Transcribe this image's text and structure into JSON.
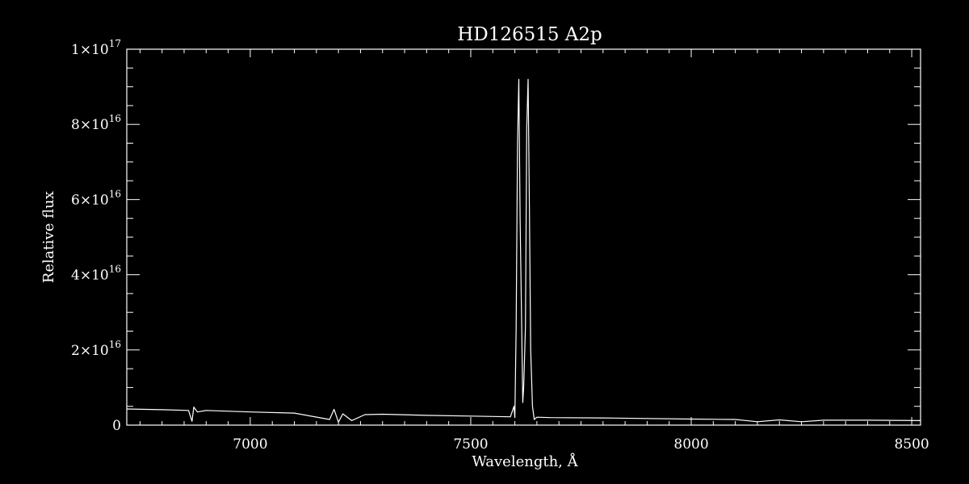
{
  "chart_data": {
    "type": "line",
    "title": "HD126515  A2p",
    "xlabel": "Wavelength, Å",
    "ylabel": "Relative flux",
    "xlim": [
      6720,
      8520
    ],
    "ylim": [
      0,
      1e+17
    ],
    "x_ticks": [
      {
        "value": 7000,
        "label": "7000"
      },
      {
        "value": 7500,
        "label": "7500"
      },
      {
        "value": 8000,
        "label": "8000"
      },
      {
        "value": 8500,
        "label": "8500"
      }
    ],
    "y_ticks": [
      {
        "value": 0,
        "mantissa": "0",
        "exponent": ""
      },
      {
        "value": 2e+16,
        "mantissa": "2×10",
        "exponent": "16"
      },
      {
        "value": 4e+16,
        "mantissa": "4×10",
        "exponent": "16"
      },
      {
        "value": 6e+16,
        "mantissa": "6×10",
        "exponent": "16"
      },
      {
        "value": 8e+16,
        "mantissa": "8×10",
        "exponent": "16"
      },
      {
        "value": 1e+17,
        "mantissa": "1×10",
        "exponent": "17"
      }
    ],
    "grid": false,
    "series": [
      {
        "color": "#ffffff",
        "x": [
          6720,
          6800,
          6860,
          6868,
          6872,
          6880,
          6900,
          7000,
          7100,
          7180,
          7190,
          7200,
          7210,
          7230,
          7260,
          7300,
          7400,
          7500,
          7590,
          7598,
          7600,
          7603,
          7606,
          7609,
          7612,
          7615,
          7618,
          7620,
          7624,
          7627,
          7630,
          7633,
          7636,
          7640,
          7644,
          7650,
          7680,
          7800,
          8000,
          8100,
          8150,
          8200,
          8250,
          8300,
          8400,
          8520
        ],
        "y": [
          4300000000000000.0,
          4100000000000000.0,
          3900000000000000.0,
          1000000000000000.0,
          4800000000000000.0,
          3500000000000000.0,
          3900000000000000.0,
          3500000000000000.0,
          3200000000000000.0,
          1500000000000000.0,
          4200000000000000.0,
          800000000000000.0,
          3000000000000000.0,
          1200000000000000.0,
          2800000000000000.0,
          2900000000000000.0,
          2600000000000000.0,
          2400000000000000.0,
          2200000000000000.0,
          5000000000000000.0,
          2000000000000000.0,
          2.6e+16,
          7.5e+16,
          9.2e+16,
          5.5e+16,
          3e+16,
          6000000000000000.0,
          1e+16,
          2.6e+16,
          7.9e+16,
          9.2e+16,
          5.8e+16,
          2e+16,
          5000000000000000.0,
          1500000000000000.0,
          2100000000000000.0,
          2000000000000000.0,
          1900000000000000.0,
          1600000000000000.0,
          1500000000000000.0,
          900000000000000.0,
          1400000000000000.0,
          900000000000000.0,
          1300000000000000.0,
          1300000000000000.0,
          1200000000000000.0
        ]
      }
    ]
  }
}
